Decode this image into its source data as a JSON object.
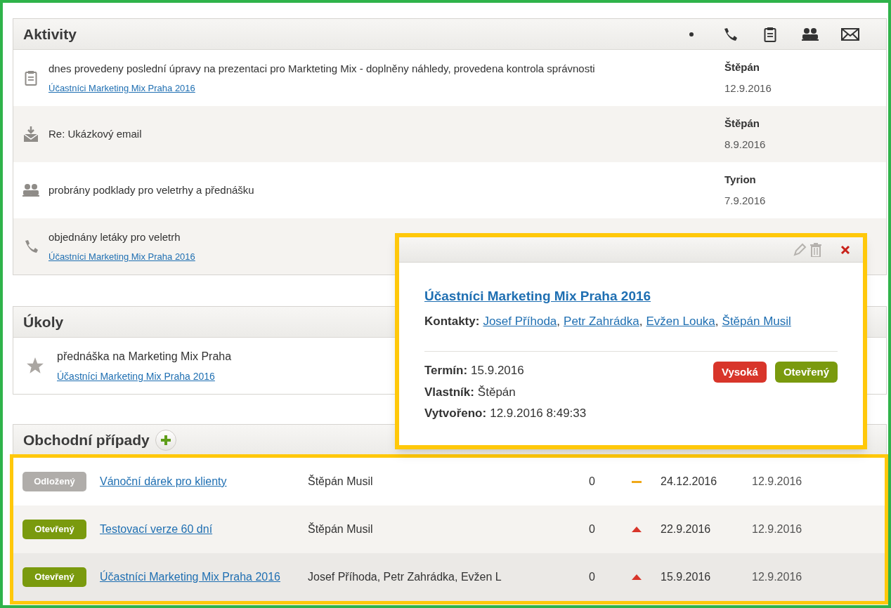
{
  "activities": {
    "title": "Aktivity",
    "filters": [
      {
        "kind": "dot"
      },
      {
        "kind": "phone"
      },
      {
        "kind": "clipboard"
      },
      {
        "kind": "people"
      },
      {
        "kind": "mail"
      }
    ],
    "rows": [
      {
        "kind": "clipboard",
        "text": "dnes provedeny poslední úpravy na prezentaci pro Markteting Mix - doplněny náhledy, provedena kontrola správnosti",
        "link": "Účastníci Marketing Mix Praha 2016",
        "author": "Štěpán",
        "date": "12.9.2016"
      },
      {
        "kind": "mail-in",
        "text": "Re: Ukázkový email",
        "author": "Štěpán",
        "date": "8.9.2016"
      },
      {
        "kind": "people",
        "text": "probrány podklady pro veletrhy a přednášku",
        "author": "Tyrion",
        "date": "7.9.2016"
      },
      {
        "kind": "phone",
        "text": "objednány letáky pro veletrh",
        "link": "Účastníci Marketing Mix Praha 2016"
      }
    ]
  },
  "tasks": {
    "title": "Úkoly",
    "rows": [
      {
        "text": "přednáška na Marketing Mix Praha",
        "link": "Účastníci Marketing Mix Praha 2016"
      }
    ]
  },
  "deals": {
    "title": "Obchodní případy",
    "rows": [
      {
        "status": "Odložený",
        "color": "#b0adaa",
        "name": "Vánoční dárek pro klienty",
        "contacts": "Štěpán Musil",
        "count": "0",
        "kind": "medium",
        "due": "24.12.2016",
        "created": "12.9.2016"
      },
      {
        "status": "Otevřený",
        "color": "#7a9a0e",
        "name": "Testovací verze 60 dní",
        "contacts": "Štěpán Musil",
        "count": "0",
        "kind": "high",
        "due": "22.9.2016",
        "created": "12.9.2016"
      },
      {
        "status": "Otevřený",
        "color": "#7a9a0e",
        "name": "Účastníci Marketing Mix Praha 2016",
        "contacts": "Josef Příhoda, Petr Zahrádka, Evžen L",
        "count": "0",
        "kind": "high",
        "due": "15.9.2016",
        "created": "12.9.2016"
      }
    ]
  },
  "popup": {
    "title": "Účastníci Marketing Mix Praha 2016",
    "contacts_label": "Kontakty:",
    "contacts": [
      "Josef Příhoda",
      "Petr Zahrádka",
      "Evžen Louka",
      "Štěpán Musil"
    ],
    "separators": [
      ",",
      ",",
      ","
    ],
    "fields": [
      {
        "label": "Termín:",
        "value": "15.9.2016"
      },
      {
        "label": "Vlastník:",
        "value": "Štěpán"
      },
      {
        "label": "Vytvořeno:",
        "value": "12.9.2016 8:49:33"
      }
    ],
    "badges": [
      {
        "text": "Vysoká",
        "color": "#d8352a"
      },
      {
        "text": "Otevřený",
        "color": "#7a9a0e"
      }
    ]
  }
}
